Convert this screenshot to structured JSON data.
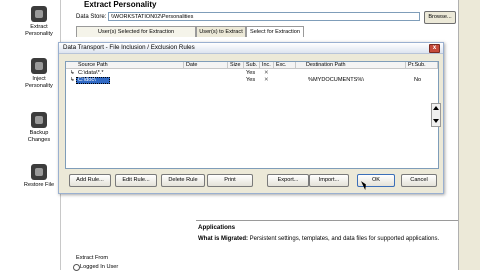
{
  "nav": {
    "extract": {
      "line1": "Extract",
      "line2": "Personality"
    },
    "inject": {
      "line1": "Inject",
      "line2": "Personality"
    },
    "backup": {
      "line1": "Backup",
      "line2": "Changes"
    },
    "restore": {
      "line1": "Restore File",
      "line2": ""
    }
  },
  "app": {
    "title": "Extract Personality",
    "datastore_label": "Data Store:",
    "datastore_value": "\\\\WORKSTATION02\\Personalities",
    "browse_label": "Browse...",
    "tabs": [
      "User(s) Selected for Extraction",
      "User(s) to Extract",
      "Select for Extraction"
    ],
    "applications_heading": "Applications",
    "what_label": "What is Migrated:",
    "what_text": " Persistent settings, templates, and data files for supported applications.",
    "extract_from": "Extract From",
    "logged_in": "Logged In User"
  },
  "dialog": {
    "title": "Data Transport - File Inclusion / Exclusion Rules",
    "close": "x",
    "columns": [
      "Source Path",
      "Date",
      "Size",
      "Sub.",
      "Inc.",
      "Exc.",
      "Destination Path",
      "Pr.Sub."
    ],
    "rows": [
      {
        "source": "C:\\data\\*.*",
        "date": "",
        "size": "",
        "sub": "Yes",
        "inc": "✕",
        "exc": "",
        "dest": "",
        "prsub": ""
      },
      {
        "source": "C:\\doc\\",
        "date": "",
        "size": "",
        "sub": "Yes",
        "inc": "✕",
        "exc": "",
        "dest": "%MYDOCUMENTS%\\",
        "prsub": "No"
      }
    ],
    "buttons": {
      "add": "Add Rule...",
      "edit": "Edit Rule...",
      "delete": "Delete Rule",
      "print": "Print",
      "export": "Export...",
      "import": "Import...",
      "ok": "OK",
      "cancel": "Cancel"
    }
  }
}
